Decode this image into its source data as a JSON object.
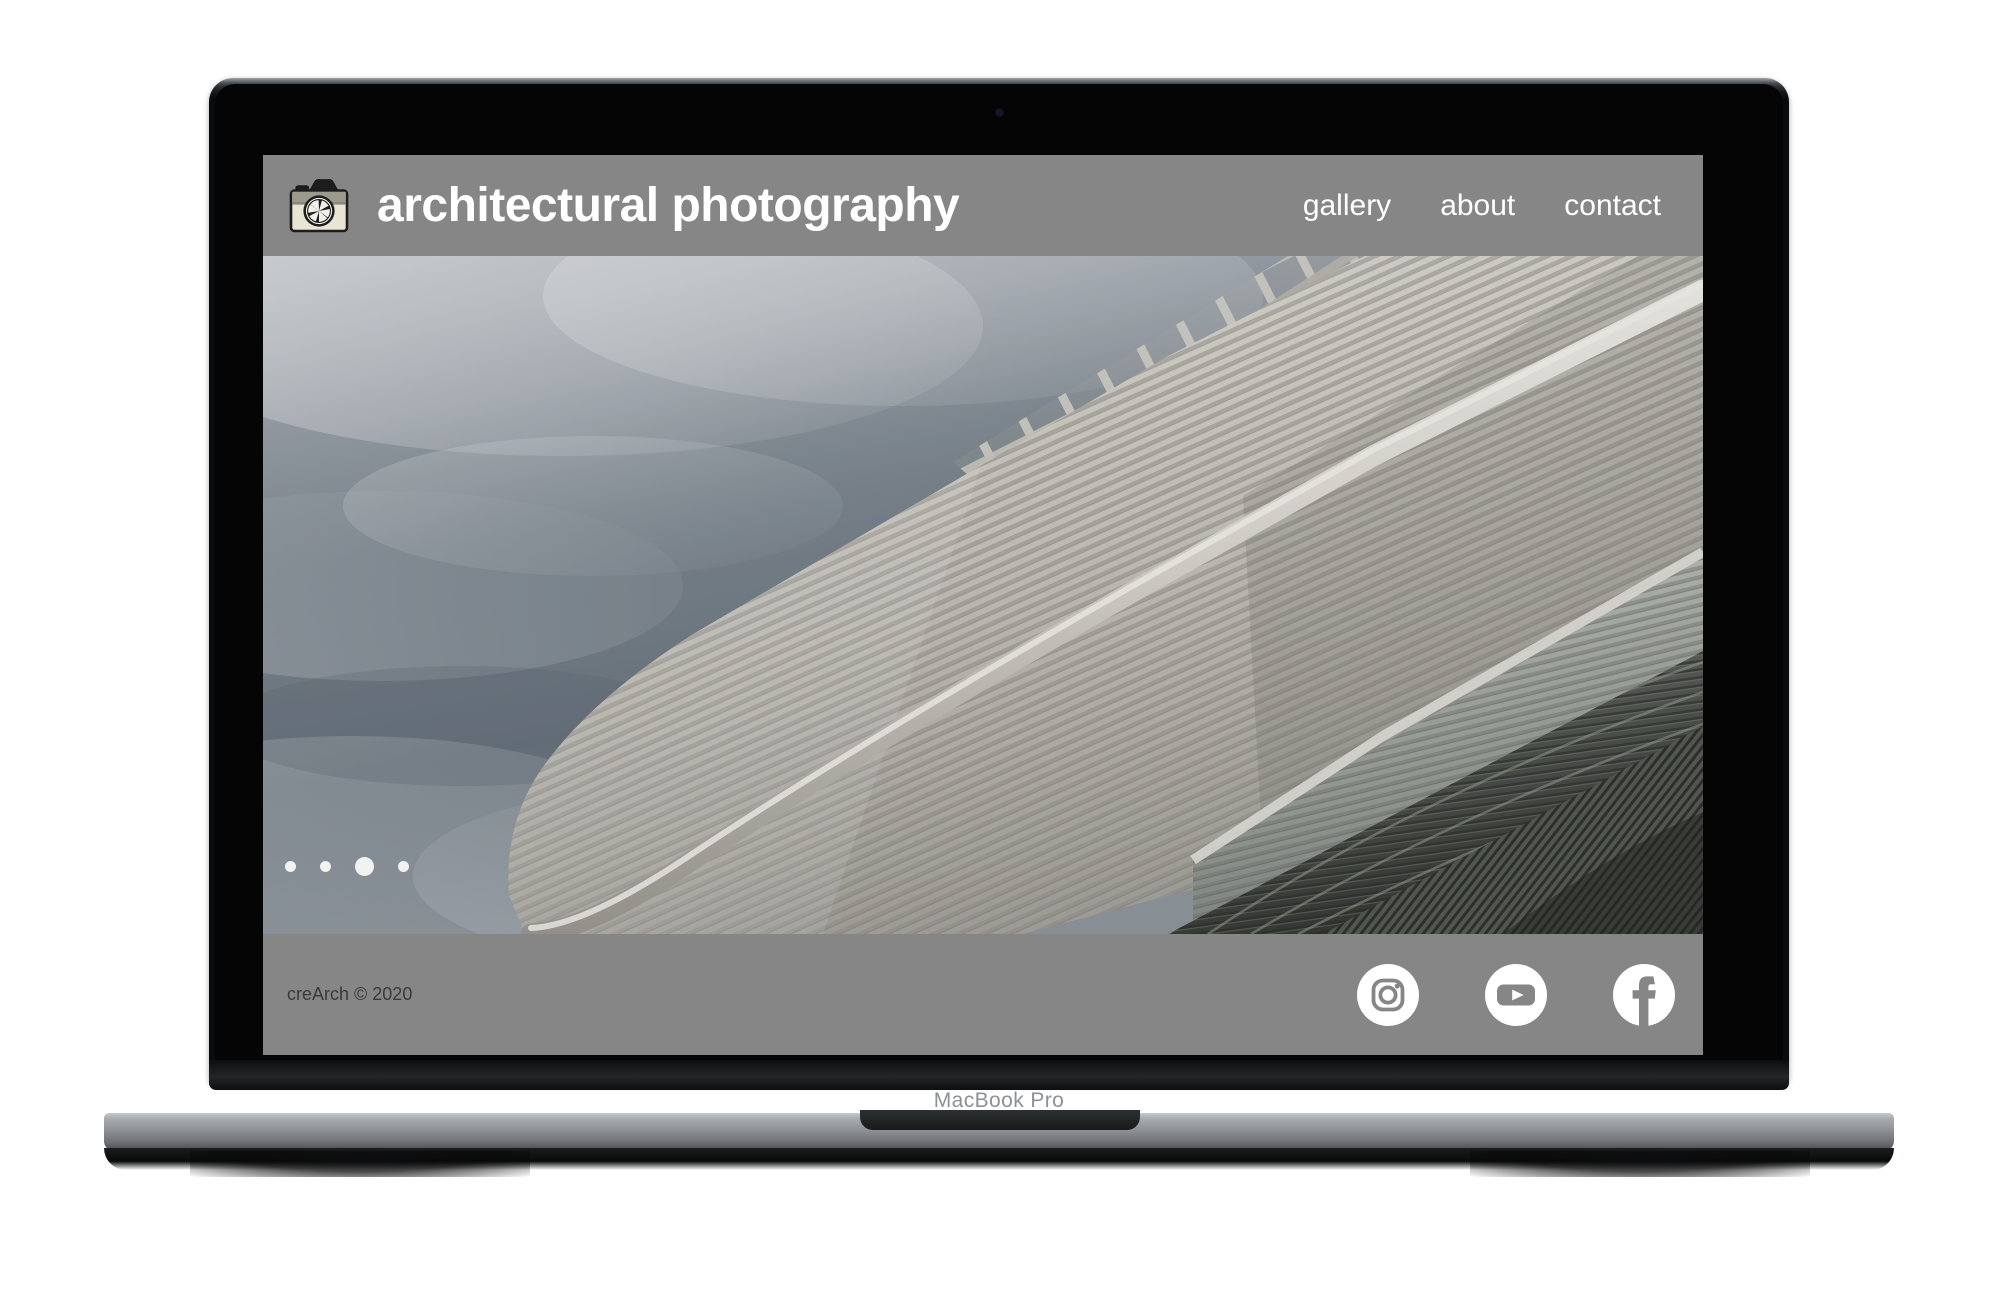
{
  "device": {
    "model_label": "MacBook Pro",
    "webcam": "webcam-dot"
  },
  "site": {
    "header": {
      "title": "architectural photography",
      "logo_icon": "camera-icon",
      "background_color": "#868686",
      "text_color": "#ffffff",
      "nav": [
        {
          "label": "gallery"
        },
        {
          "label": "about"
        },
        {
          "label": "contact"
        }
      ]
    },
    "hero": {
      "alt": "architectural photograph of a white ribbed curved canopy and lattice roof structure against an overcast sky",
      "carousel": {
        "count": 4,
        "active_index": 2,
        "dots": [
          {
            "label": "slide 1",
            "active": false
          },
          {
            "label": "slide 2",
            "active": false
          },
          {
            "label": "slide 3",
            "active": true
          },
          {
            "label": "slide 4",
            "active": false
          }
        ]
      }
    },
    "footer": {
      "copyright": "creArch © 2020",
      "background_color": "#868686",
      "text_color": "#3a3a3a",
      "social": [
        {
          "name": "instagram-icon",
          "label": "Instagram"
        },
        {
          "name": "youtube-icon",
          "label": "YouTube"
        },
        {
          "name": "facebook-icon",
          "label": "Facebook"
        }
      ]
    }
  }
}
